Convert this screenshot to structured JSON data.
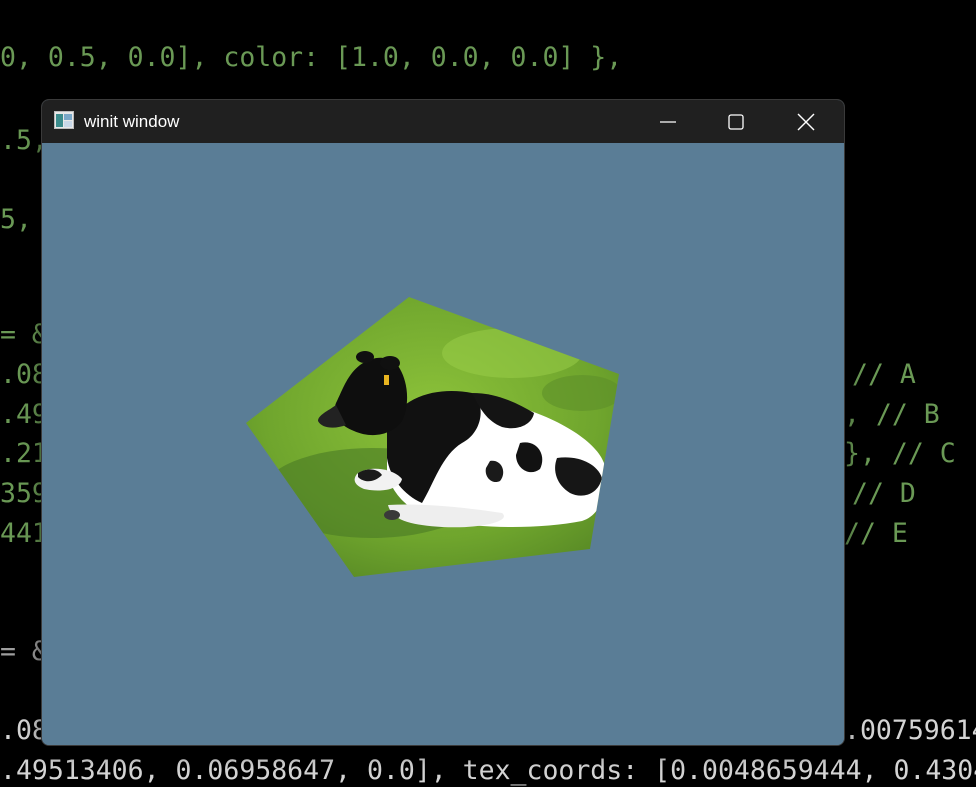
{
  "background_code": {
    "lines": [
      "0, 0.5, 0.0], color: [1.0, 0.0, 0.0] },",
      ".5,",
      "5,",
      "= &",
      ".08",
      ".49",
      ".21",
      "359",
      "441",
      "= &",
      ".08",
      ".49513406, 0.06958647, 0.0], tex_coords: [0.0048659444, 0.4304"
    ],
    "right_comments": [
      "// A",
      ", // B",
      "}, // C",
      "// D",
      "// E"
    ],
    "right_number": ".00759614"
  },
  "window": {
    "title": "winit window",
    "icon": "app-window-icon",
    "controls": {
      "minimize_icon": "minimize-icon",
      "maximize_icon": "maximize-icon",
      "close_icon": "close-icon"
    },
    "clear_color": "#5a7d96",
    "titlebar_color": "#202020"
  },
  "scene": {
    "shape": "pentagon",
    "texture": "cow lying on grass",
    "vertex_labels": [
      "A",
      "B",
      "C",
      "D",
      "E"
    ]
  }
}
